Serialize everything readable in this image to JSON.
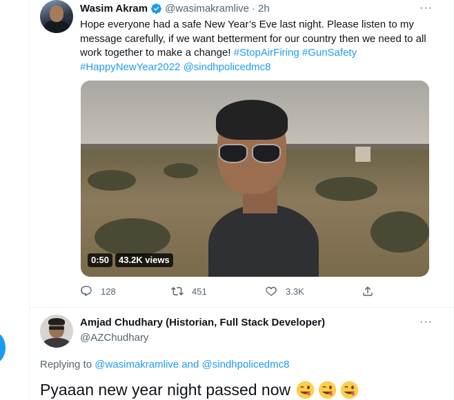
{
  "tweet": {
    "author_name": "Wasim Akram",
    "handle": "@wasimakramlive",
    "separator": "·",
    "time": "2h",
    "more_label": "···",
    "text_before": "Hope everyone had a safe New Year’s Eve last night. Please listen to my message carefully, if we want betterment for our country then we need to all work together to make a change! ",
    "hashtags": [
      "#StopAirFiring",
      "#GunSafety",
      "#HappyNewYear2022"
    ],
    "mention": "@sindhpolicedmc8",
    "video": {
      "duration": "0:50",
      "views": "43.2K views"
    },
    "actions": {
      "replies": "128",
      "retweets": "451",
      "likes": "3.3K"
    }
  },
  "reply": {
    "author_name": "Amjad Chudhary (Historian, Full Stack Developer)",
    "handle": "@AZChudhary",
    "more_label": "···",
    "replying_prefix": "Replying to ",
    "replying_user1": "@wasimakramlive",
    "replying_and": " and ",
    "replying_user2": "@sindhpolicedmc8",
    "text": "Pyaaan new year night passed now",
    "emoji_icon": "winking-face-with-tongue-icon"
  },
  "colors": {
    "accent": "#1d9bf0",
    "text": "#0f1419",
    "muted": "#536471"
  }
}
